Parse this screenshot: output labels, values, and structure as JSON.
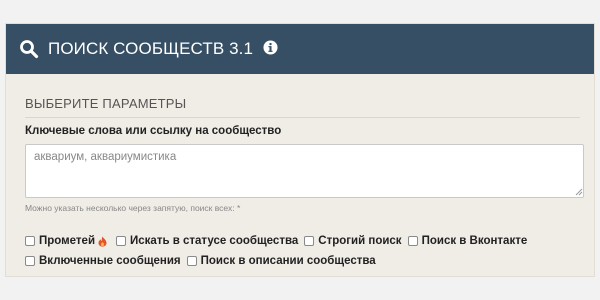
{
  "header": {
    "title": "ПОИСК СООБЩЕСТВ 3.1",
    "search_icon": "search-icon",
    "info_icon": "info-icon"
  },
  "section": {
    "title": "ВЫБЕРИТЕ ПАРАМЕТРЫ"
  },
  "keywords": {
    "label": "Ключевые слова или ссылку на сообщество",
    "placeholder": "аквариум, аквариумистика",
    "value": "",
    "hint": "Можно указать несколько через запятую, поиск всех: *"
  },
  "options": {
    "row1": [
      {
        "label": "Прометей",
        "checked": false,
        "icon": "fire-icon"
      },
      {
        "label": "Искать в статусе сообщества",
        "checked": false
      },
      {
        "label": "Строгий поиск",
        "checked": false
      },
      {
        "label": "Поиск в Вконтакте",
        "checked": false
      }
    ],
    "row2": [
      {
        "label": "Включенные сообщения",
        "checked": false
      },
      {
        "label": "Поиск в описании сообщества",
        "checked": false
      }
    ]
  },
  "colors": {
    "header_bg": "#374f64",
    "panel_bg": "#f0ece6",
    "fire": "#e5532d"
  }
}
